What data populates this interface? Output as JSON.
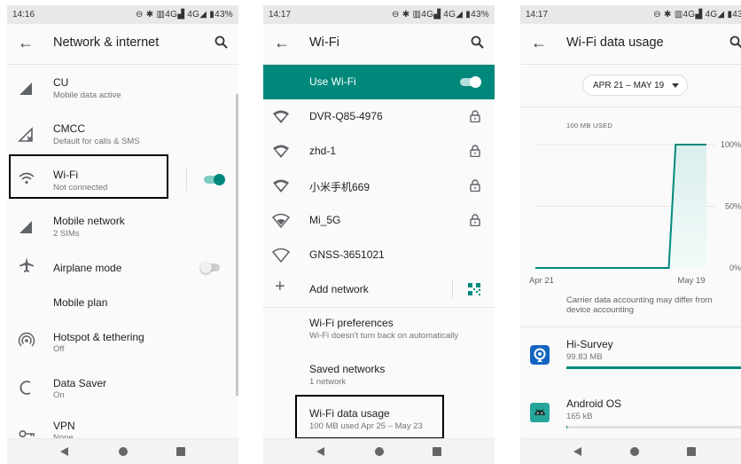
{
  "screen1": {
    "status": {
      "time": "14:16",
      "icons": "⊖ ✱ ▥4G▟ 4G◢ ▮43%",
      "battery": "43%"
    },
    "title": "Network & internet",
    "items": [
      {
        "title": "CU",
        "subtitle": "Mobile data active"
      },
      {
        "title": "CMCC",
        "subtitle": "Default for calls & SMS"
      },
      {
        "title": "Wi-Fi",
        "subtitle": "Not connected"
      },
      {
        "title": "Mobile network",
        "subtitle": "2 SIMs"
      },
      {
        "title": "Airplane mode",
        "subtitle": ""
      },
      {
        "title": "Mobile plan",
        "subtitle": ""
      },
      {
        "title": "Hotspot & tethering",
        "subtitle": "Off"
      },
      {
        "title": "Data Saver",
        "subtitle": "On"
      },
      {
        "title": "VPN",
        "subtitle": "None"
      }
    ]
  },
  "screen2": {
    "status": {
      "time": "14:17",
      "icons": "⊖ ✱ ▥4G▟ 4G◢ ▮43%"
    },
    "title": "Wi-Fi",
    "use_wifi": "Use Wi-Fi",
    "networks": [
      {
        "name": "DVR-Q85-4976",
        "locked": true
      },
      {
        "name": "zhd-1",
        "locked": true
      },
      {
        "name": "小米手机669",
        "locked": true
      },
      {
        "name": "Mi_5G",
        "locked": true
      },
      {
        "name": "GNSS-3651021",
        "locked": false
      }
    ],
    "add_network": "Add network",
    "preferences": {
      "title": "Wi-Fi preferences",
      "subtitle": "Wi-Fi doesn't turn back on automatically"
    },
    "saved": {
      "title": "Saved networks",
      "subtitle": "1 network"
    },
    "usage": {
      "title": "Wi-Fi data usage",
      "subtitle": "100 MB used Apr 25 – May 23"
    }
  },
  "screen3": {
    "status": {
      "time": "14:17",
      "icons": "⊖ ✱ ▥4G▟ 4G◢ ▮43"
    },
    "title": "Wi-Fi data usage",
    "date_range": "APR 21 – MAY 19",
    "chart_data": {
      "type": "area",
      "title": "100 MB USED",
      "x_labels": [
        "Apr 21",
        "May 19"
      ],
      "y_ticks": [
        "100%",
        "50%",
        "0%"
      ],
      "points": [
        [
          0,
          0
        ],
        [
          0.78,
          0
        ],
        [
          0.82,
          1.0
        ],
        [
          1.0,
          1.0
        ]
      ]
    },
    "note": "Carrier data accounting may differ from device accounting",
    "apps": [
      {
        "name": "Hi-Survey",
        "usage": "99.83 MB",
        "fraction": 1.0,
        "color": "#1565c0"
      },
      {
        "name": "Android OS",
        "usage": "165 kB",
        "fraction": 0.002,
        "color": "#3ddc84"
      }
    ],
    "colors": {
      "accent": "#00897b",
      "chart_fill": "#d9efec"
    }
  }
}
